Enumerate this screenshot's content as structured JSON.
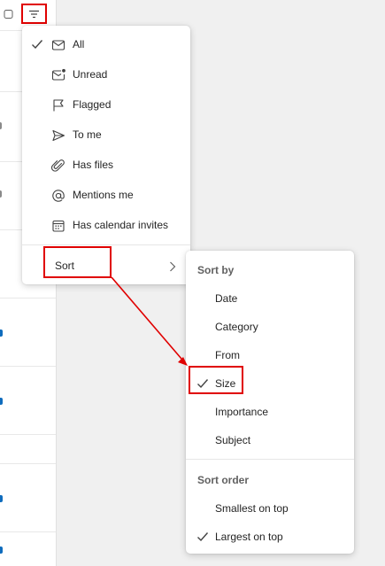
{
  "filter_menu": {
    "items": [
      {
        "label": "All",
        "icon": "mail-icon",
        "checked": true
      },
      {
        "label": "Unread",
        "icon": "mail-unread-icon",
        "checked": false
      },
      {
        "label": "Flagged",
        "icon": "flag-icon",
        "checked": false
      },
      {
        "label": "To me",
        "icon": "send-icon",
        "checked": false
      },
      {
        "label": "Has files",
        "icon": "paperclip-icon",
        "checked": false
      },
      {
        "label": "Mentions me",
        "icon": "at-mention-icon",
        "checked": false
      },
      {
        "label": "Has calendar invites",
        "icon": "calendar-icon",
        "checked": false
      }
    ],
    "sort_label": "Sort"
  },
  "sort_menu": {
    "sort_by_heading": "Sort by",
    "sort_by_options": [
      {
        "label": "Date",
        "checked": false
      },
      {
        "label": "Category",
        "checked": false
      },
      {
        "label": "From",
        "checked": false
      },
      {
        "label": "Size",
        "checked": true
      },
      {
        "label": "Importance",
        "checked": false
      },
      {
        "label": "Subject",
        "checked": false
      }
    ],
    "sort_order_heading": "Sort order",
    "sort_order_options": [
      {
        "label": "Smallest on top",
        "checked": false
      },
      {
        "label": "Largest on top",
        "checked": true
      }
    ]
  },
  "colors": {
    "highlight": "#e00000",
    "accent": "#0f6cbd",
    "text": "#242424",
    "heading_text": "#616161"
  }
}
